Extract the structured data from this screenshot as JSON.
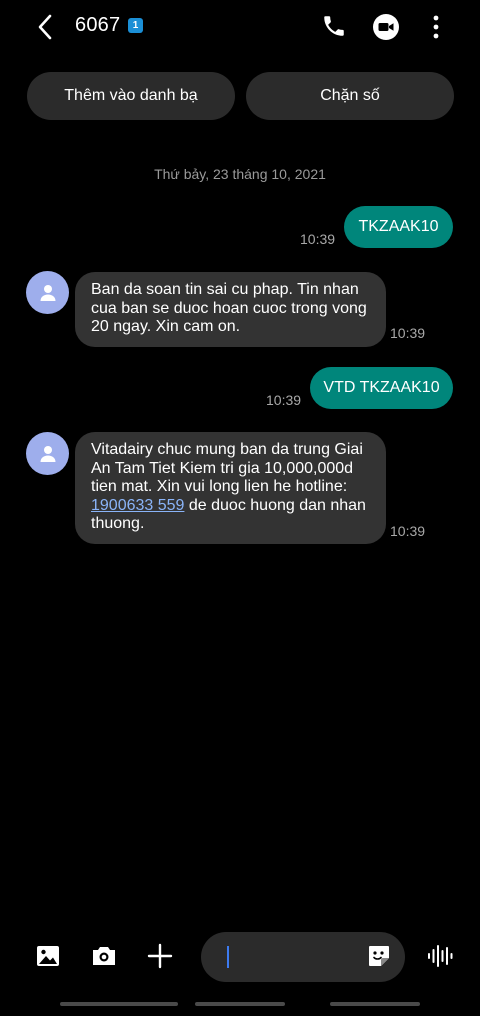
{
  "header": {
    "title": "6067",
    "sim_badge": "1"
  },
  "actions": {
    "add_contact": "Thêm vào danh bạ",
    "block_number": "Chặn số"
  },
  "conversation": {
    "date": "Thứ bảy, 23 tháng 10, 2021",
    "messages": [
      {
        "direction": "outgoing",
        "text": "TKZAAK10",
        "time": "10:39"
      },
      {
        "direction": "incoming",
        "lines": [
          "Ban da soan tin sai cu phap. Tin nhan",
          "cua ban se duoc hoan cuoc trong vong",
          "20 ngay. Xin cam on."
        ],
        "time": "10:39"
      },
      {
        "direction": "outgoing",
        "text": "VTD TKZAAK10",
        "time": "10:39"
      },
      {
        "direction": "incoming",
        "lines": [
          "Vitadairy chuc mung ban da trung Giai",
          "An Tam Tiet Kiem tri gia 10,000,000d",
          "tien mat. Xin vui long lien he hotline:"
        ],
        "link": "1900633 559",
        "after_link": " de duoc huong dan nhan",
        "last_line": "thuong.",
        "time": "10:39"
      }
    ]
  },
  "composer": {
    "placeholder": ""
  },
  "colors": {
    "outgoing_bubble": "#00867b",
    "incoming_bubble": "#333333",
    "avatar": "#9eaeec",
    "link": "#8ab4f8"
  },
  "icons": [
    "back-icon",
    "phone-icon",
    "video-call-icon",
    "more-icon",
    "contact-avatar-icon",
    "gallery-icon",
    "camera-icon",
    "plus-icon",
    "sticker-icon",
    "voice-icon"
  ]
}
